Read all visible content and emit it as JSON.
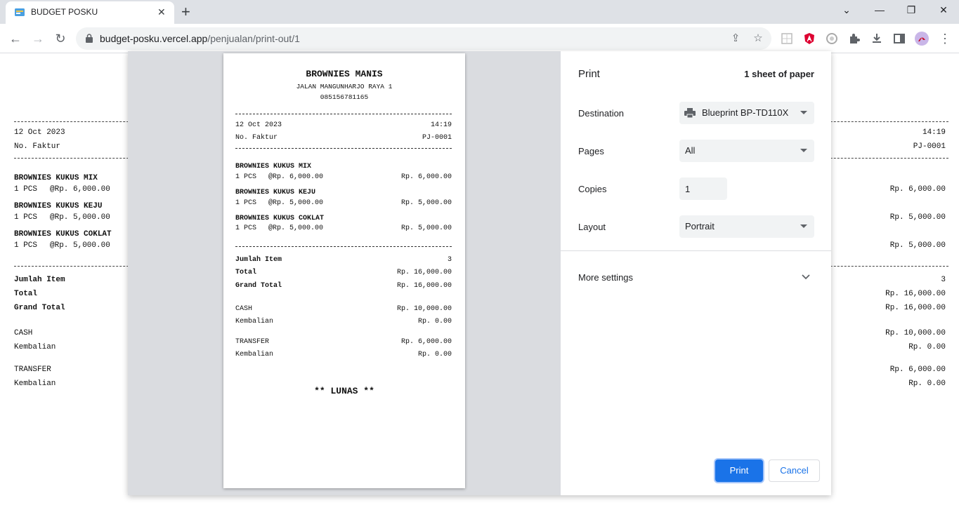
{
  "browser": {
    "tab_title": "BUDGET POSKU",
    "url_host": "budget-posku.vercel.app",
    "url_path": "/penjualan/print-out/1"
  },
  "page": {
    "date": "12 Oct 2023",
    "time": "14:19",
    "invoice_label": "No. Faktur",
    "invoice_no": "PJ-0001",
    "items": [
      {
        "name": "BROWNIES KUKUS MIX",
        "qty": "1 PCS",
        "price": "@Rp. 6,000.00",
        "subtotal": "Rp. 6,000.00"
      },
      {
        "name": "BROWNIES KUKUS KEJU",
        "qty": "1 PCS",
        "price": "@Rp. 5,000.00",
        "subtotal": "Rp. 5,000.00"
      },
      {
        "name": "BROWNIES KUKUS COKLAT",
        "qty": "1 PCS",
        "price": "@Rp. 5,000.00",
        "subtotal": "Rp. 5,000.00"
      }
    ],
    "jumlah_item_label": "Jumlah Item",
    "jumlah_item": "3",
    "total_label": "Total",
    "total": "Rp. 16,000.00",
    "grand_total_label": "Grand Total",
    "grand_total": "Rp. 16,000.00",
    "cash_label": "CASH",
    "cash": "Rp. 10,000.00",
    "kembalian_label": "Kembalian",
    "kembalian_cash": "Rp. 0.00",
    "transfer_label": "TRANSFER",
    "transfer": "Rp. 6,000.00",
    "kembalian_transfer": "Rp. 0.00"
  },
  "receipt": {
    "store_name": "BROWNIES MANIS",
    "address": "JALAN MANGUNHARJO RAYA 1",
    "phone": "085156781165",
    "status": "** LUNAS **"
  },
  "print": {
    "title": "Print",
    "sheets": "1 sheet of paper",
    "destination_label": "Destination",
    "destination": "Blueprint BP-TD110X",
    "pages_label": "Pages",
    "pages": "All",
    "copies_label": "Copies",
    "copies": "1",
    "layout_label": "Layout",
    "layout": "Portrait",
    "more_settings": "More settings",
    "print_button": "Print",
    "cancel_button": "Cancel"
  },
  "colors": {
    "accent": "#1a73e8",
    "angular_ext": "#dd0031"
  }
}
